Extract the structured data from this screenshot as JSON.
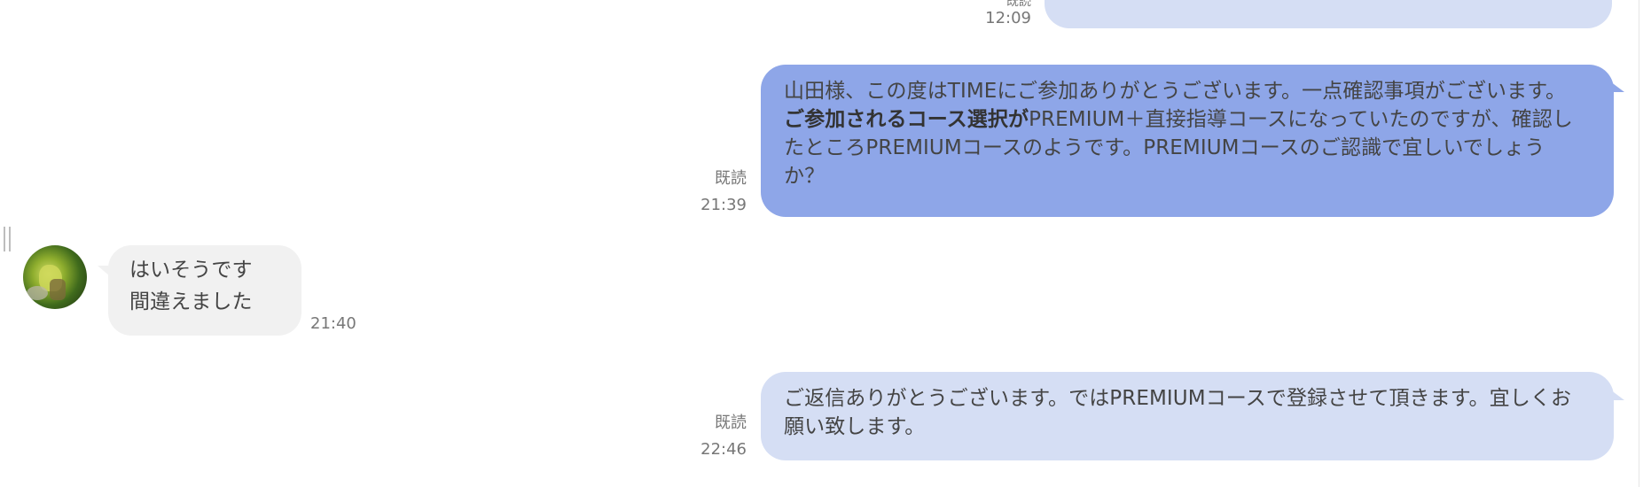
{
  "messages": [
    {
      "id": "m1",
      "direction": "outgoing",
      "read_label": "",
      "time": "12:09",
      "partial_top_label": "既読"
    },
    {
      "id": "m2",
      "direction": "outgoing",
      "read_label": "既読",
      "time": "21:39",
      "text_before_bold": "山田様、この度はTIMEにご参加ありがとうございます。一点確認事項がございます。",
      "text_bold": "ご参加されるコース選択が",
      "text_after_bold": "PREMIUM＋直接指導コースになっていたのですが、確認したところPREMIUMコースのようです。PREMIUMコースのご認識で宜しいでしょうか？"
    },
    {
      "id": "m3",
      "direction": "incoming",
      "time": "21:40",
      "line1": "はいそうです",
      "line2": "間違えました"
    },
    {
      "id": "m4",
      "direction": "outgoing",
      "read_label": "既読",
      "time": "22:46",
      "text": "ご返信ありがとうございます。ではPREMIUMコースで登録させて頂きます。宜しくお願い致します。"
    }
  ],
  "colors": {
    "outgoing_pale": "#d5def4",
    "outgoing_selected": "#8ea6e8",
    "incoming": "#f1f1f1"
  },
  "icons": {
    "avatar": "user-avatar-photo",
    "resize": "resize-handle-icon"
  }
}
